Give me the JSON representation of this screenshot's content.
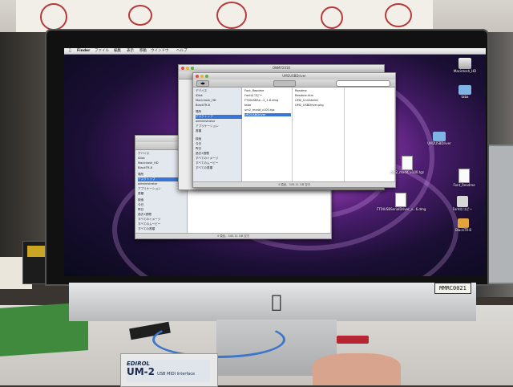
{
  "menubar": {
    "app": "Finder",
    "items": [
      "ファイル",
      "編集",
      "表示",
      "移動",
      "ウインドウ",
      "ヘルプ"
    ]
  },
  "front_window": {
    "title": "UM2USBDriver",
    "status": "4 項目、545.11 GB 空き"
  },
  "back_window": {
    "title": "ONMY2016",
    "status": "4 項目、545.11 GB 空き"
  },
  "sidebar": {
    "devices_header": "デバイス",
    "devices": [
      "iDisk",
      "Macintosh_HD",
      "BlackTR-8"
    ],
    "places_header": "場所",
    "places": [
      "デスクトップ",
      "administrator",
      "アプリケーション",
      "書類"
    ],
    "search_header": "検索",
    "search": [
      "今日",
      "昨日",
      "過去1週間",
      "すべてのイメージ",
      "すべてのムービー",
      "すべての書類"
    ]
  },
  "column1": [
    "Font_Readme",
    "Fontのコピー",
    "FTDIUSBSe...2_1.8.dmg",
    "taba",
    "um2_mxdd_v100.tgz",
    "UM2USBDriver"
  ],
  "column2": [
    "Readme",
    "Readme.htm",
    "UM2_Uninstaller",
    "UM2_USBDriver.pkg"
  ],
  "desktop_icons": [
    {
      "label": "Macintosh_HD",
      "icon": "hard-drive-icon"
    },
    {
      "label": "taba",
      "icon": "folder-icon"
    },
    {
      "label": "UM2USBDriver",
      "icon": "folder-icon"
    },
    {
      "label": "Font_Readme",
      "icon": "document-icon"
    },
    {
      "label": "um2_mxdd_v100.tgz",
      "icon": "archive-icon"
    },
    {
      "label": "Fontのコピー",
      "icon": "installer-icon"
    },
    {
      "label": "FTDIUSBSerialDriver_v...6.dmg",
      "icon": "disk-image-icon"
    },
    {
      "label": "BlackTR-8",
      "icon": "drive-icon"
    }
  ],
  "asset_tag": "MMRC0021",
  "usb_interface": {
    "brand": "EDIROL",
    "model": "UM-2",
    "subtitle": "USB MIDI Interface"
  },
  "colors": {
    "selection": "#3875d7",
    "wallpaper": "#9a3fb8"
  }
}
